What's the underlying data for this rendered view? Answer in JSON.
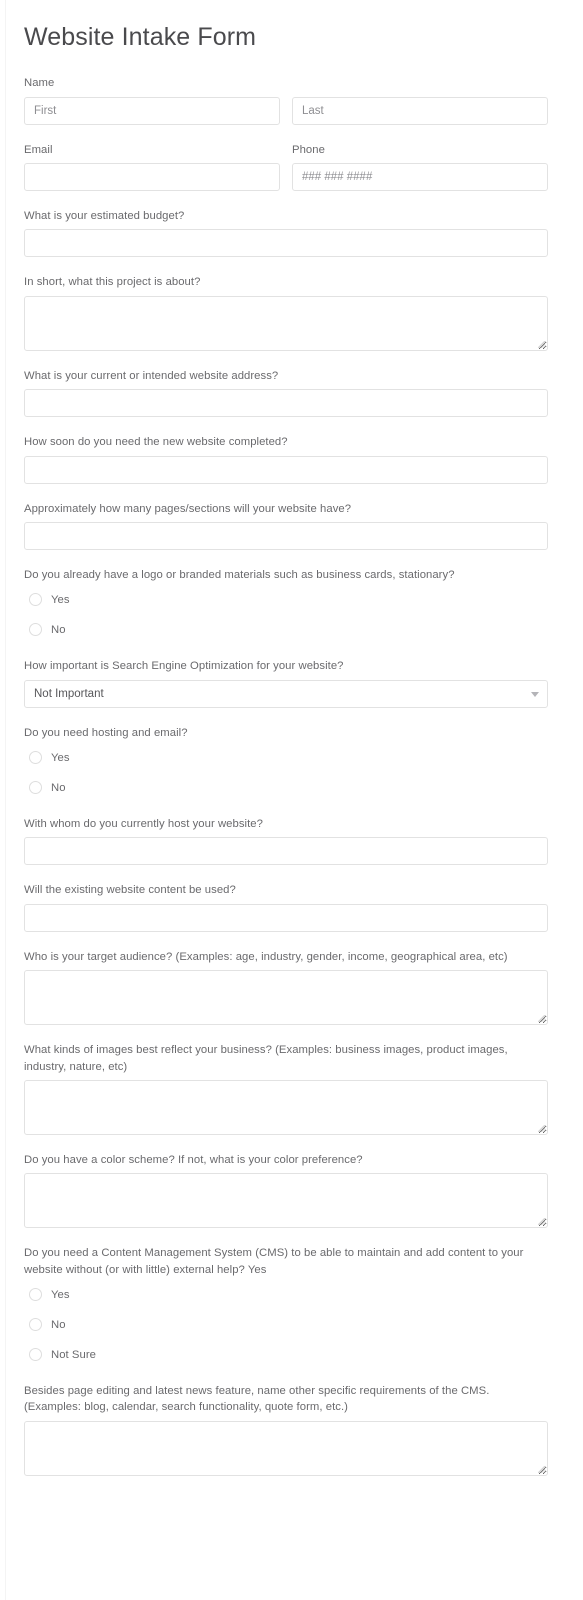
{
  "form": {
    "title": "Website Intake Form",
    "name_label": "Name",
    "first_placeholder": "First",
    "last_placeholder": "Last",
    "email_label": "Email",
    "email_value": "",
    "phone_label": "Phone",
    "phone_placeholder": "### ### ####",
    "fields": [
      {
        "id": "budget",
        "type": "text",
        "label": "What is your estimated budget?",
        "value": ""
      },
      {
        "id": "project-about",
        "type": "textarea",
        "label": "In short, what this project is about?",
        "value": ""
      },
      {
        "id": "website-address",
        "type": "text",
        "label": "What is your current or intended website address?",
        "value": ""
      },
      {
        "id": "timeline",
        "type": "text",
        "label": "How soon do you need the new website completed?",
        "value": ""
      },
      {
        "id": "page-count",
        "type": "text",
        "label": "Approximately how many pages/sections will your website have?",
        "value": ""
      },
      {
        "id": "has-logo",
        "type": "radio",
        "label": "Do you already have a logo or branded materials such as business cards, stationary?",
        "options": [
          "Yes",
          "No"
        ],
        "selected": ""
      },
      {
        "id": "seo-importance",
        "type": "select",
        "label": "How important is Search Engine Optimization for your website?",
        "value": "Not Important"
      },
      {
        "id": "needs-hosting",
        "type": "radio",
        "label": "Do you need hosting and email?",
        "options": [
          "Yes",
          "No"
        ],
        "selected": ""
      },
      {
        "id": "current-host",
        "type": "text",
        "label": "With whom do you currently host your website?",
        "value": ""
      },
      {
        "id": "existing-content",
        "type": "text",
        "label": "Will the existing website content be used?",
        "value": ""
      },
      {
        "id": "target-audience",
        "type": "textarea",
        "label": "Who is your target audience? (Examples: age, industry, gender, income, geographical area, etc)",
        "value": ""
      },
      {
        "id": "image-kinds",
        "type": "textarea",
        "label": "What kinds of images best reflect your business? (Examples: business images, product images, industry, nature, etc)",
        "value": ""
      },
      {
        "id": "color-scheme",
        "type": "textarea",
        "label": "Do you have a color scheme? If not, what is your color preference?",
        "value": ""
      },
      {
        "id": "needs-cms",
        "type": "radio",
        "label": "Do you need a Content Management System (CMS) to be able to maintain and add content to your website without (or with little) external help? Yes",
        "options": [
          "Yes",
          "No",
          "Not Sure"
        ],
        "selected": ""
      },
      {
        "id": "cms-requirements",
        "type": "textarea",
        "label": "Besides page editing and latest news feature, name other specific requirements of the CMS. (Examples: blog, calendar, search functionality, quote form, etc.)",
        "value": ""
      }
    ]
  },
  "colors": {
    "page_background": "#ffffff",
    "title_text": "#4a4a4d",
    "label_text": "#6a6a6d",
    "input_border": "#e2e2e2",
    "placeholder_text": "#8e8e92",
    "radio_border": "#dedede",
    "select_arrow": "#b4b4b8"
  }
}
